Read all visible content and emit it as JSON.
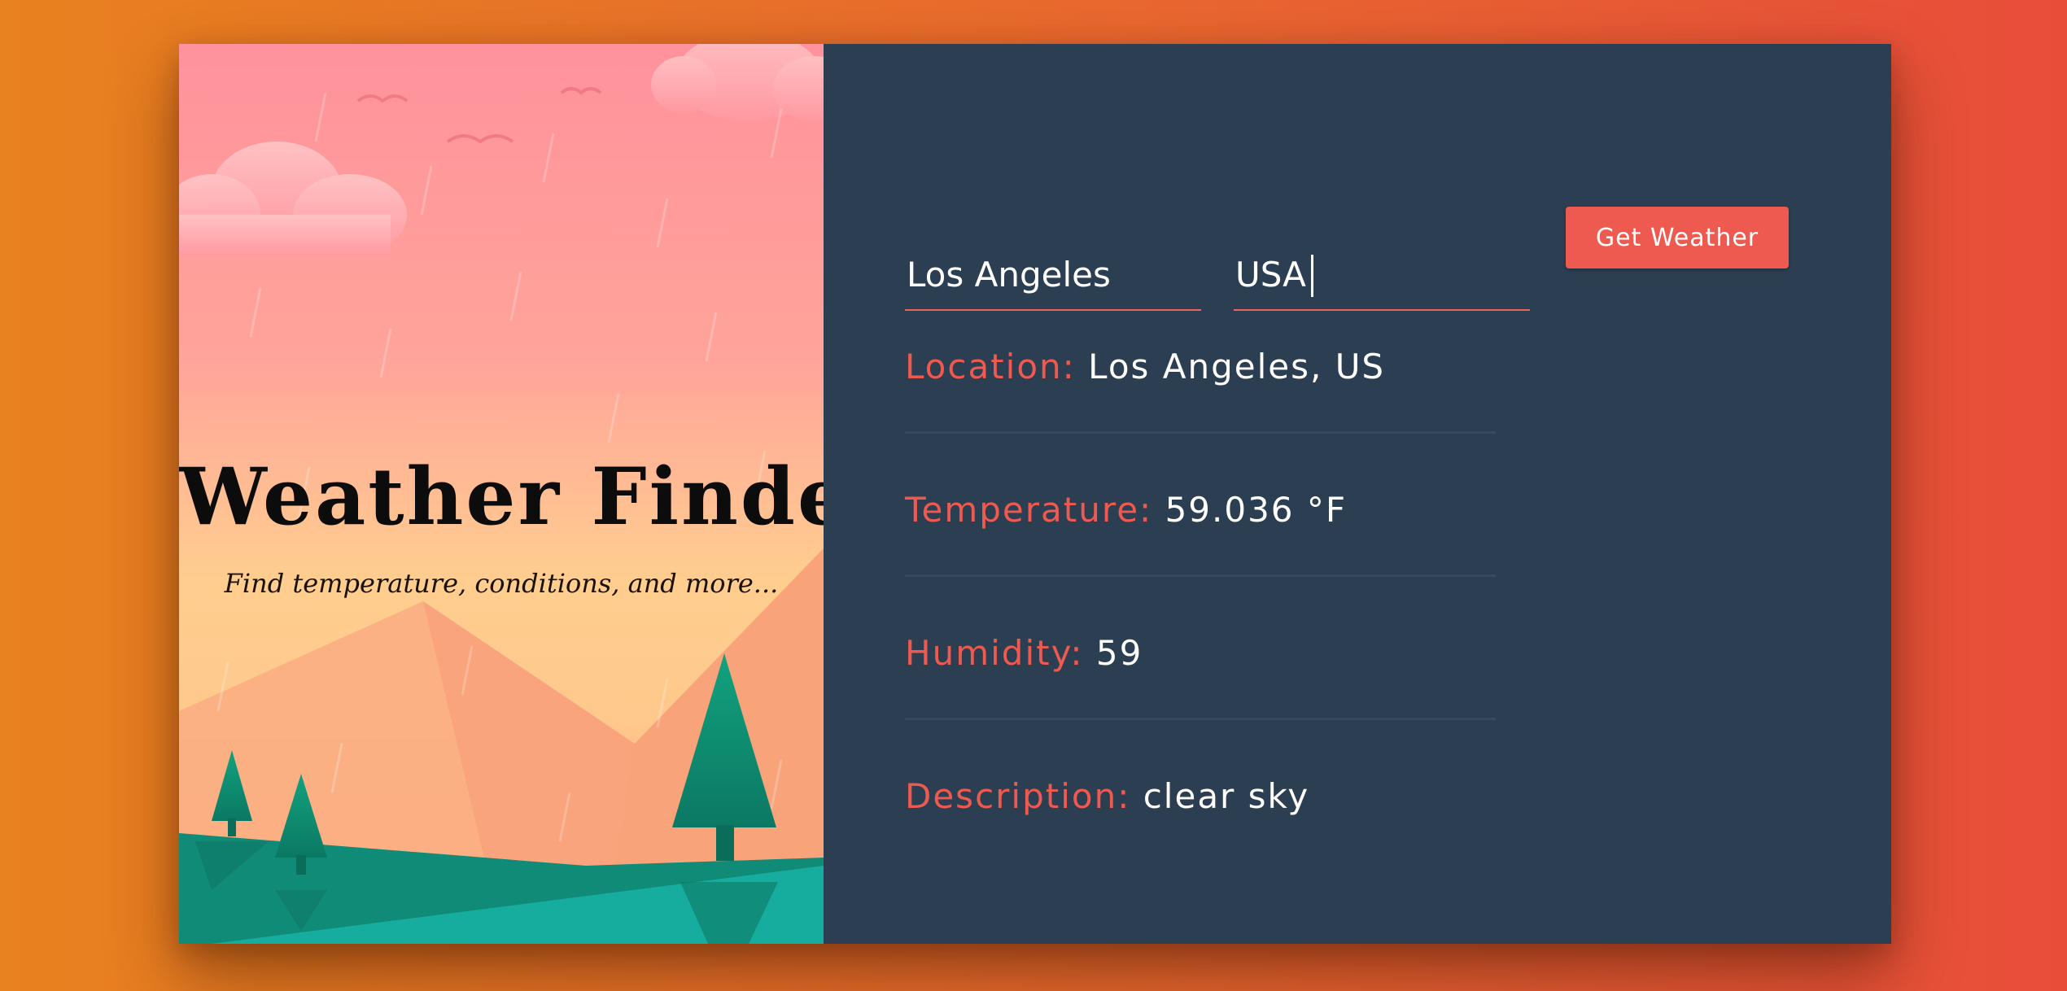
{
  "hero": {
    "title": "Weather Finder",
    "subtitle": "Find temperature, conditions, and more..."
  },
  "form": {
    "city_value": "Los Angeles",
    "country_value": "USA",
    "button_label": "Get Weather"
  },
  "results": [
    {
      "label": "Location:",
      "value": "Los Angeles, US"
    },
    {
      "label": "Temperature:",
      "value": "59.036 °F"
    },
    {
      "label": "Humidity:",
      "value": "59"
    },
    {
      "label": "Description:",
      "value": "clear sky"
    }
  ],
  "colors": {
    "accent": "#ee5a4f",
    "panel": "#2c3e51",
    "background_start": "#e8811f",
    "background_end": "#e84d3a",
    "tree": "#0e8a6e",
    "ground": "#14a89a"
  }
}
